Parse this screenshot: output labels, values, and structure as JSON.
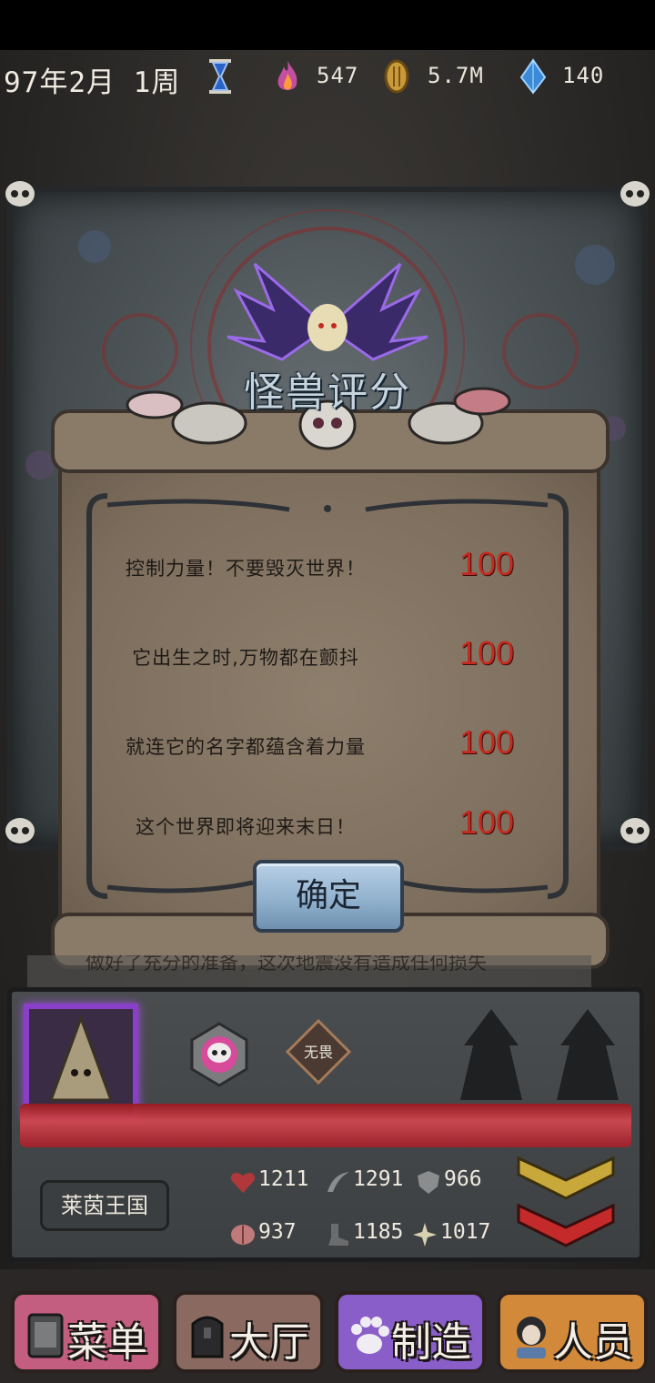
{
  "hud": {
    "date": "97年2月 1周",
    "flame_value": "547",
    "gold_value": "5.7M",
    "crystal_value": "140"
  },
  "dialog": {
    "title": "怪兽评分",
    "rows": [
      {
        "text": "控制力量！不要毁灭世界！",
        "score": "100"
      },
      {
        "text": "它出生之时,万物都在颤抖",
        "score": "100"
      },
      {
        "text": "就连它的名字都蕴含着力量",
        "score": "100"
      },
      {
        "text": "这个世界即将迎来末日！",
        "score": "100"
      }
    ],
    "confirm_label": "确定"
  },
  "log_text": "做好了充分的准备，这次地震没有造成任何损失",
  "panel": {
    "trait": "无畏",
    "kingdom": "莱茵王国",
    "stats": {
      "hp": "1211",
      "attack": "1291",
      "defense": "966",
      "intellect": "937",
      "speed": "1185",
      "magic": "1017"
    }
  },
  "nav": {
    "menu": "菜单",
    "hall": "大厅",
    "craft": "制造",
    "staff": "人员"
  },
  "colors": {
    "score_red": "#c42a1f",
    "portrait_frame": "#8a3fc8",
    "hp_bar": "#d04850",
    "nav_menu": "#c45e80",
    "nav_hall": "#8a6a60",
    "nav_craft": "#8a5ec8",
    "nav_staff": "#d28a3a"
  }
}
